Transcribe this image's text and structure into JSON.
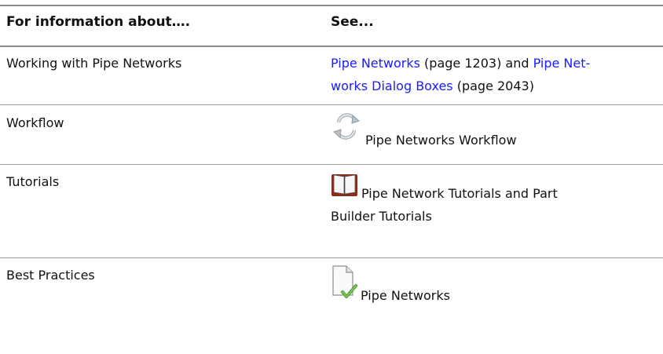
{
  "header": {
    "col1": "For information about….",
    "col2": "See..."
  },
  "rows": [
    {
      "topic": "Working with Pipe Networks",
      "see": {
        "link1": "Pipe Networks",
        "page1": " (page 1203) and ",
        "link2a": "Pipe Net-",
        "link2b": "works Dialog Boxes",
        "page2": " (page 2043)"
      }
    },
    {
      "topic": "Workflow",
      "icon": "workflow-cycle-icon",
      "see_text": "Pipe Networks Workflow"
    },
    {
      "topic": "Tutorials",
      "icon": "tutorial-book-icon",
      "see_line1": "Pipe Network Tutorials and Part",
      "see_line2": "Builder Tutorials"
    },
    {
      "topic": "Best Practices",
      "icon": "best-practice-document-check-icon",
      "see_text": "Pipe Networks"
    }
  ]
}
